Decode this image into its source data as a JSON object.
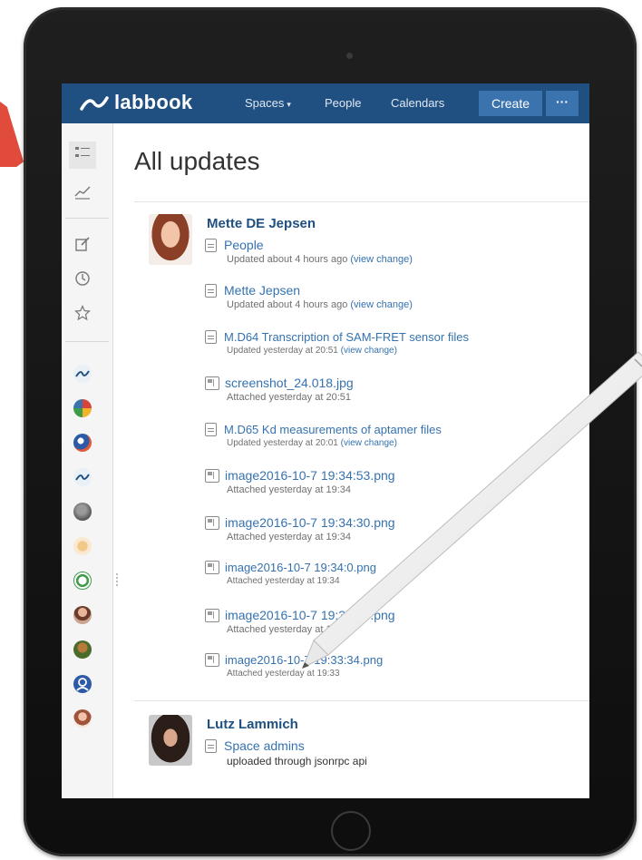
{
  "app": {
    "logo_text": "labbook",
    "nav": {
      "spaces": "Spaces",
      "people": "People",
      "calendars": "Calendars",
      "create": "Create",
      "more": "···"
    }
  },
  "page": {
    "title": "All updates"
  },
  "feed": [
    {
      "user": "Mette DE Jepsen",
      "updates": [
        {
          "type": "page",
          "title": "People",
          "meta": "Updated about 4 hours ago",
          "link": "(view change)"
        },
        {
          "type": "page",
          "title": "Mette Jepsen",
          "meta": "Updated about 4 hours ago",
          "link": "(view change)"
        },
        {
          "type": "page",
          "title": "M.D64 Transcription of SAM-FRET sensor files",
          "meta": "Updated yesterday at 20:51",
          "link": "(view change)"
        },
        {
          "type": "image",
          "title": "screenshot_24.018.jpg",
          "meta": "Attached yesterday at 20:51",
          "link": ""
        },
        {
          "type": "page",
          "title": "M.D65 Kd measurements of aptamer files",
          "meta": "Updated yesterday at 20:01",
          "link": "(view change)"
        },
        {
          "type": "image",
          "title": "image2016-10-7 19:34:53.png",
          "meta": "Attached yesterday at 19:34",
          "link": ""
        },
        {
          "type": "image",
          "title": "image2016-10-7 19:34:30.png",
          "meta": "Attached yesterday at 19:34",
          "link": ""
        },
        {
          "type": "image",
          "title": "image2016-10-7 19:34:0.png",
          "meta": "Attached yesterday at 19:34",
          "link": ""
        },
        {
          "type": "image",
          "title": "image2016-10-7 19:33:47.png",
          "meta": "Attached yesterday at 19:33",
          "link": ""
        },
        {
          "type": "image",
          "title": "image2016-10-7 19:33:34.png",
          "meta": "Attached yesterday at 19:33",
          "link": ""
        }
      ]
    },
    {
      "user": "Lutz Lammich",
      "updates": [
        {
          "type": "page",
          "title": "Space admins",
          "meta": "uploaded through jsonrpc api",
          "link": ""
        }
      ]
    }
  ],
  "colors": {
    "nav_bg": "#205081",
    "accent": "#3b73af",
    "link": "#3572b0",
    "pencil": "#f2f2f2"
  },
  "icons": [
    "activity-icon",
    "analytics-icon",
    "draft-icon",
    "recent-icon",
    "starred-icon",
    "document-icon",
    "image-file-icon"
  ]
}
